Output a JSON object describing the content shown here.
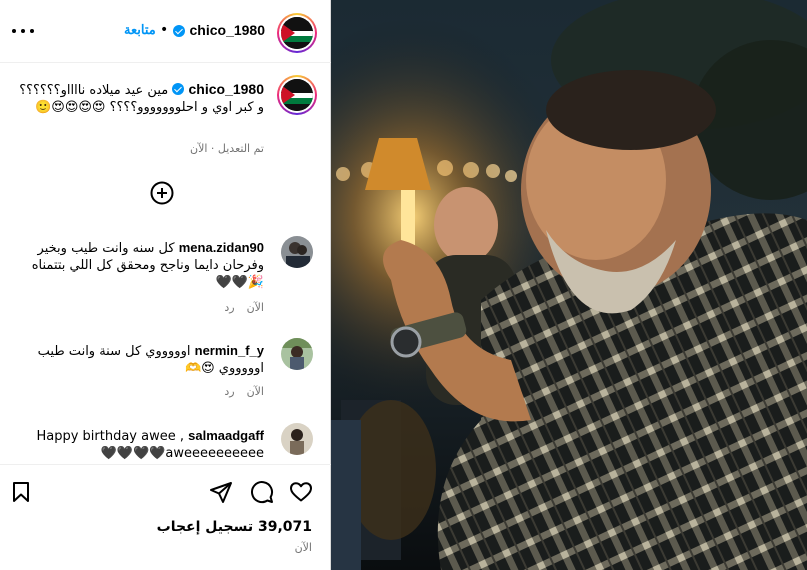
{
  "post": {
    "username": "chico_1980",
    "follow_label": "متابعة",
    "dot": "•",
    "caption_text": "مين عيد ميلاده نااااو؟؟؟؟؟؟ و كبر اوي و احلووووووو؟؟؟؟ 😍😍😍😍🙂",
    "caption_meta": "تم التعديل · الآن",
    "likes": "39,071 تسجيل إعجاب",
    "time": "الآن"
  },
  "comments": [
    {
      "username": "mena.zidan90",
      "text": "كل سنه وانت طيب وبخير وفرحان دايما وناجح ومحقق كل اللي بتتمناه 🎉🖤🖤",
      "time": "الآن",
      "reply": "رد"
    },
    {
      "username": "nermin_f_y",
      "text": "اوووووي كل سنة وانت طيب اوووووي 😍🫶",
      "time": "الآن",
      "reply": "رد"
    },
    {
      "username": "salmaadgaff",
      "text": "Happy birthday awee , aweeeeeeeeee🖤🖤🖤🖤",
      "time": "",
      "reply": ""
    }
  ],
  "colors": {
    "accent": "#0095f6",
    "meta": "#737373",
    "flag_red": "#ce1126",
    "flag_green": "#007a3d"
  },
  "icons": [
    "more-options-icon",
    "verified-badge-icon",
    "add-comment-icon",
    "save-bookmark-icon",
    "share-icon",
    "comment-icon",
    "like-heart-icon"
  ]
}
